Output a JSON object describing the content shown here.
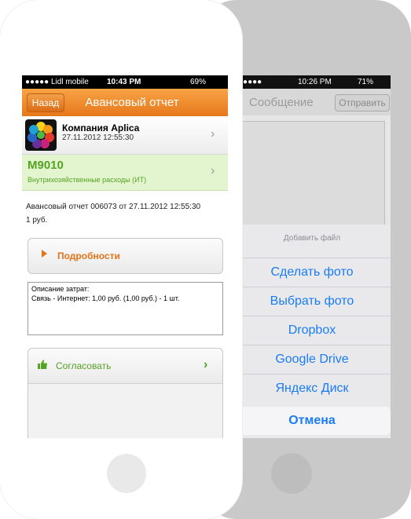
{
  "back_phone": {
    "status": {
      "carrier_dots": "●●●●●",
      "time": "10:26 PM",
      "battery": "71%"
    },
    "nav": {
      "title": "Сообщение",
      "send_button": "Отправить"
    },
    "sheet": {
      "title": "Добавить файл",
      "items": [
        "Сделать фото",
        "Выбрать фото",
        "Dropbox",
        "Google Drive",
        "Яндекс Диск"
      ],
      "cancel": "Отмена"
    }
  },
  "front_phone": {
    "status": {
      "carrier": "●●●●● Lidl mobile",
      "time": "10:43 PM",
      "battery": "69%"
    },
    "nav": {
      "back_button": "Назад",
      "title": "Авансовый отчет"
    },
    "company": {
      "name": "Компания Aplica",
      "date": "27.11.2012 12:55:30"
    },
    "code": {
      "value": "M9010",
      "description": "Внутрихозяйственные расходы (ИТ)"
    },
    "report_line": "Авансовый отчет 006073 от 27.11.2012 12:55:30",
    "amount_line": "1 руб.",
    "details_label": "Подробности",
    "expense": {
      "title": "Описание затрат:",
      "text": "Связь - Интернет: 1,00 руб. (1,00 руб.) - 1 шт."
    },
    "approve_label": "Согласовать"
  },
  "colors": {
    "accent_orange": "#e8781c",
    "accent_green": "#55a323",
    "ios_blue": "#1a7cf4"
  }
}
